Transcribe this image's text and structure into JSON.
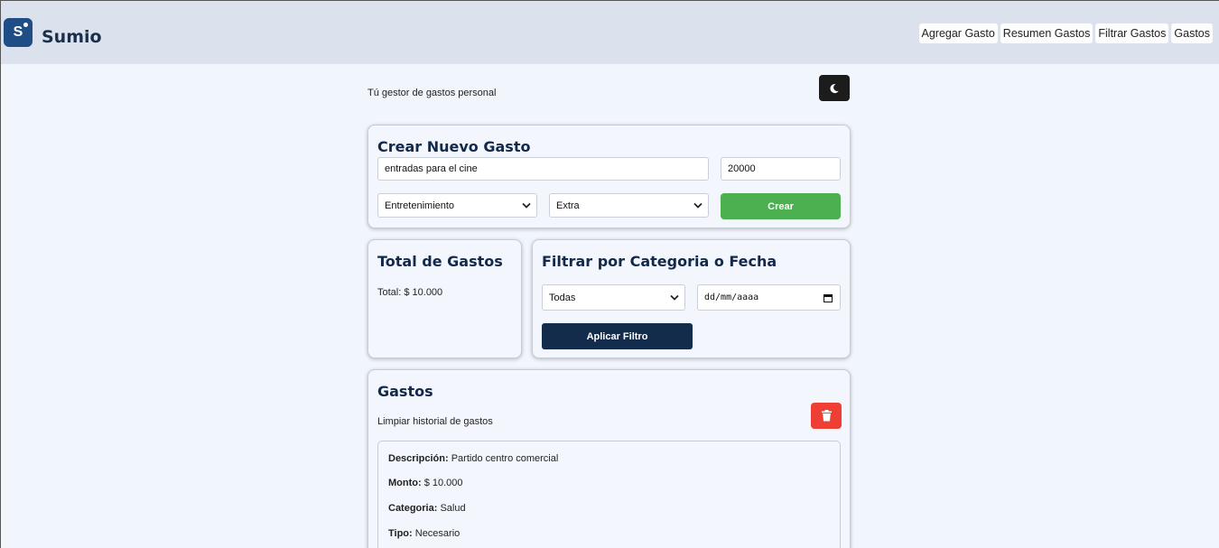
{
  "app": {
    "name": "Sumio",
    "logo_letter": "S"
  },
  "nav": [
    "Agregar Gasto",
    "Resumen Gastos",
    "Filtrar Gastos",
    "Gastos"
  ],
  "subtitle": "Tú gestor de gastos personal",
  "create": {
    "title": "Crear Nuevo Gasto",
    "description_value": "entradas para el cine",
    "amount_value": "20000",
    "category_value": "Entretenimiento",
    "type_value": "Extra",
    "submit_label": "Crear"
  },
  "total": {
    "title": "Total de Gastos",
    "text": "Total: $ 10.000"
  },
  "filter": {
    "title": "Filtrar por Categoria o Fecha",
    "category_value": "Todas",
    "date_placeholder": "dd/mm/aaaa",
    "apply_label": "Aplicar Filtro"
  },
  "list": {
    "title": "Gastos",
    "clear_text": "Limpiar historial de gastos",
    "items": [
      {
        "description_label": "Descripción:",
        "description": "Partido centro comercial",
        "amount_label": "Monto:",
        "amount": "$ 10.000",
        "category_label": "Categoria:",
        "category": "Salud",
        "type_label": "Tipo:",
        "type": "Necesario"
      }
    ]
  },
  "colors": {
    "accent_green": "#4caf50",
    "navy": "#142c4c",
    "danger": "#ef3f35",
    "header_bg": "#dbe2ee"
  },
  "icons": {
    "theme_toggle": "moon-icon",
    "clear": "trash-icon",
    "select": "chevron-down-icon",
    "date": "calendar-icon"
  }
}
